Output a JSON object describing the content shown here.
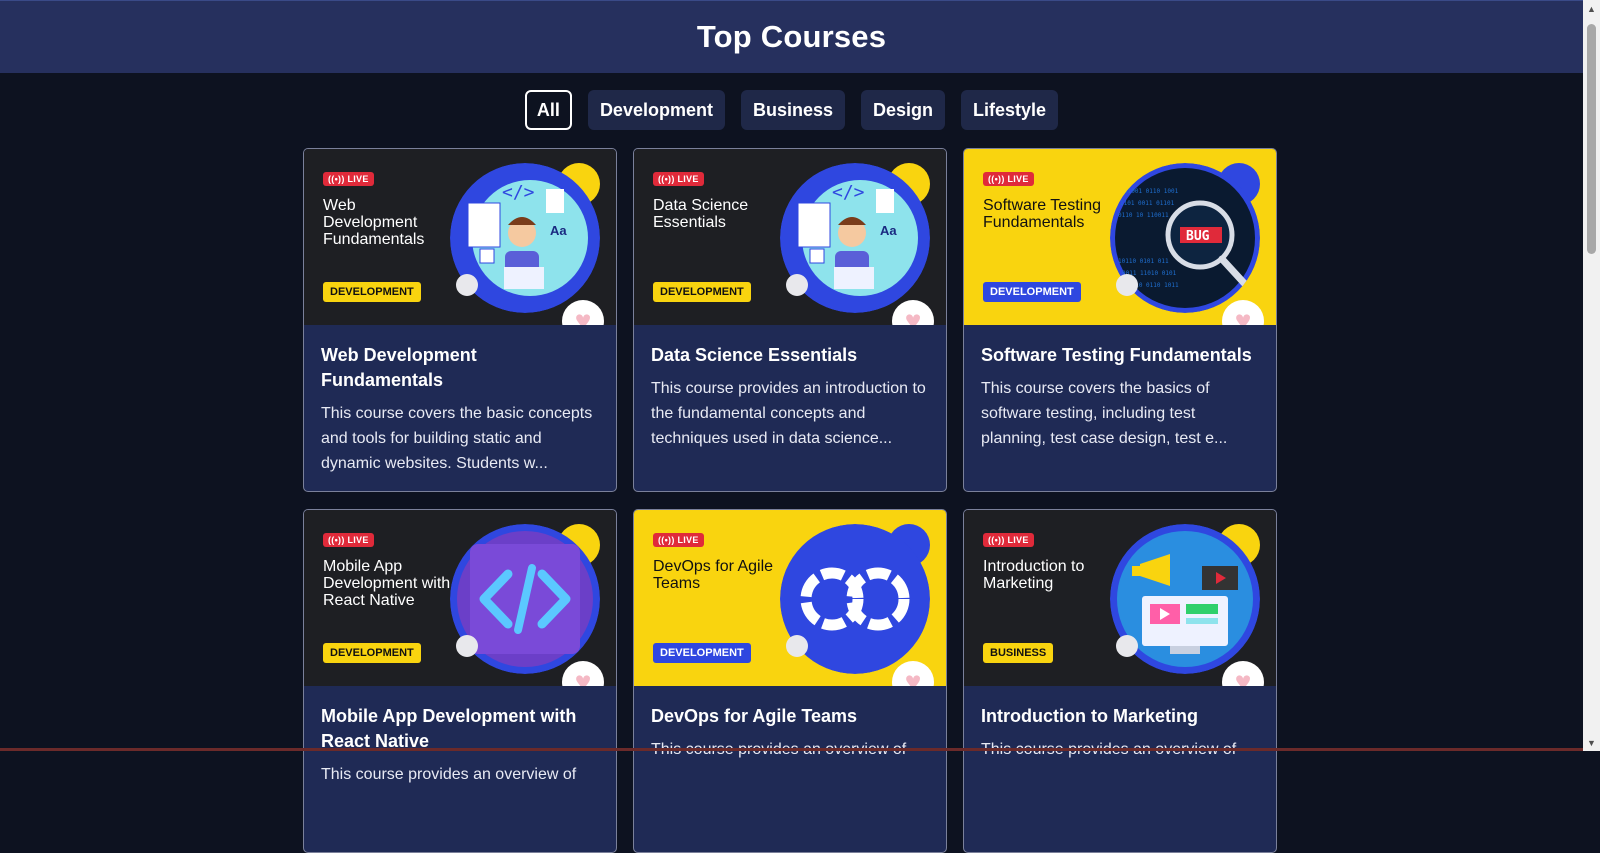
{
  "header": {
    "title": "Top Courses"
  },
  "filters": [
    {
      "label": "All",
      "active": true
    },
    {
      "label": "Development",
      "active": false
    },
    {
      "label": "Business",
      "active": false
    },
    {
      "label": "Design",
      "active": false
    },
    {
      "label": "Lifestyle",
      "active": false
    }
  ],
  "courses": [
    {
      "thumb_title": "Web Development Fundamentals",
      "live": "LIVE",
      "tag": "DEVELOPMENT",
      "title": "Web Development Fundamentals",
      "description": "This course covers the basic concepts and tools for building static and dynamic websites. Students w..."
    },
    {
      "thumb_title": "Data Science Essentials",
      "live": "LIVE",
      "tag": "DEVELOPMENT",
      "title": "Data Science Essentials",
      "description": "This course provides an introduction to the fundamental concepts and techniques used in data science..."
    },
    {
      "thumb_title": "Software Testing Fundamentals",
      "live": "LIVE",
      "tag": "DEVELOPMENT",
      "title": "Software Testing Fundamentals",
      "description": "This course covers the basics of software testing, including test planning, test case design, test e...",
      "thumb_bug": "BUG"
    },
    {
      "thumb_title": "Mobile App Development with React Native",
      "live": "LIVE",
      "tag": "DEVELOPMENT",
      "title": "Mobile App Development with React Native",
      "description": "This course provides an overview of"
    },
    {
      "thumb_title": "DevOps for Agile Teams",
      "live": "LIVE",
      "tag": "DEVELOPMENT",
      "title": "DevOps for Agile Teams",
      "description": "This course provides an overview of"
    },
    {
      "thumb_title": "Introduction to Marketing",
      "live": "LIVE",
      "tag": "BUSINESS",
      "title": "Introduction to Marketing",
      "description": "This course provides an overview of"
    }
  ],
  "icons": {
    "heart": "heart-icon",
    "live": "broadcast-icon"
  },
  "colors": {
    "header_bg": "#26305e",
    "page_bg": "#0d1220",
    "card_bg": "#1f2a55",
    "accent_yellow": "#f9d40f",
    "accent_blue": "#2f47e0",
    "live_red": "#e02a3a"
  }
}
